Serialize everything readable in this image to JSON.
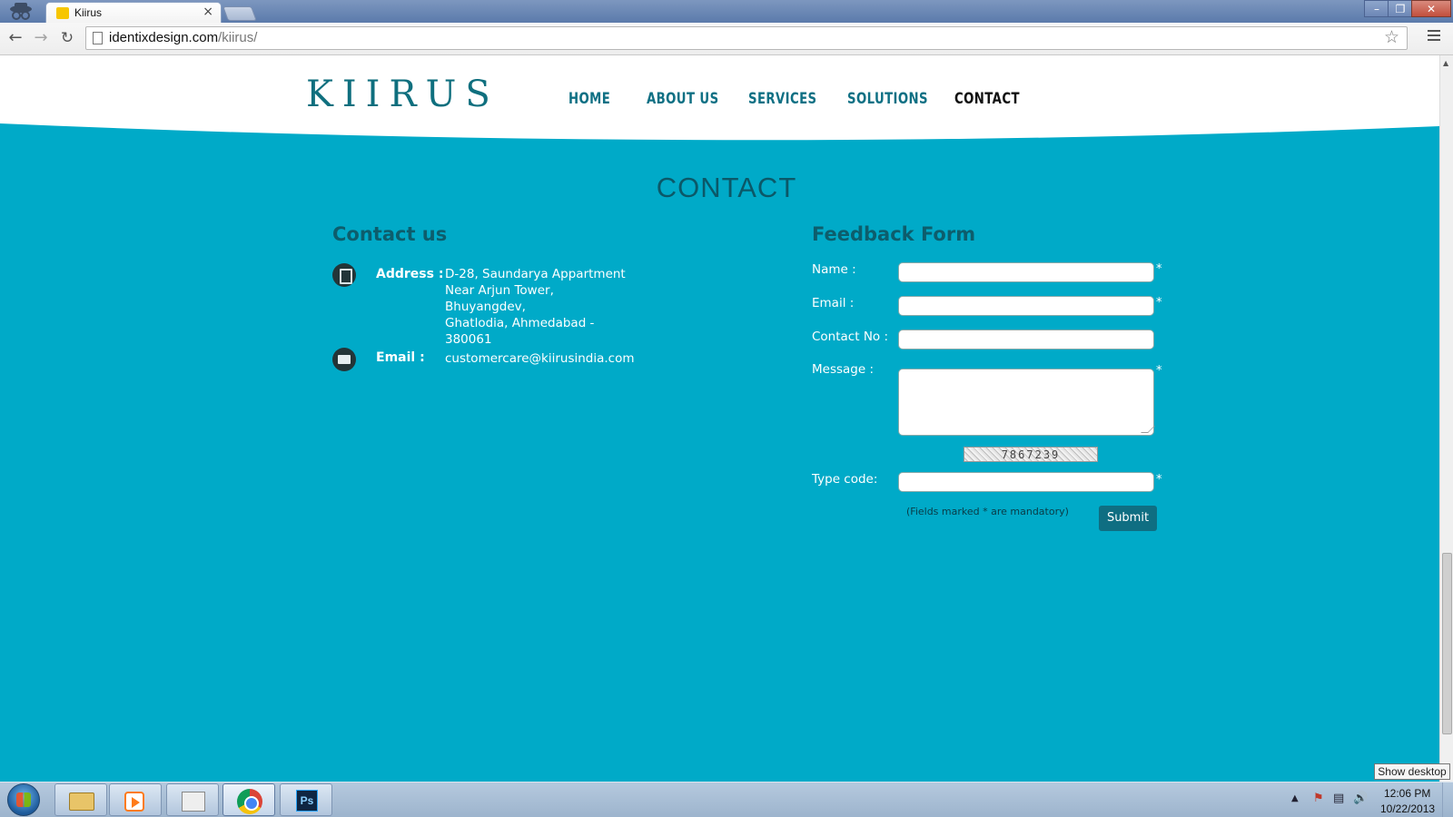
{
  "browser": {
    "tab_title": "Kiirus",
    "tab_close": "×",
    "url_host": "identixdesign.com",
    "url_path": "/kiirus/",
    "window_controls": {
      "minimize": "–",
      "maximize": "❐",
      "close": "✕"
    },
    "icons": [
      "incognito-icon",
      "favicon-icon",
      "back-icon",
      "forward-icon",
      "reload-icon",
      "page-icon",
      "star-icon",
      "menu-icon"
    ]
  },
  "site": {
    "logo": "KIIRUS",
    "nav": [
      "HOME",
      "ABOUT US",
      "SERVICES",
      "SOLUTIONS",
      "CONTACT"
    ],
    "active_nav": "CONTACT",
    "page_heading": "CONTACT",
    "colors": {
      "background": "#00aac8",
      "nav": "#0f7084",
      "heading": "#0b5868",
      "button": "#0f6e82"
    }
  },
  "contact": {
    "title": "Contact us",
    "address_label": "Address :",
    "address_lines": [
      "D-28, Saundarya Appartment",
      "Near Arjun Tower,",
      "Bhuyangdev,",
      "Ghatlodia, Ahmedabad -",
      "380061"
    ],
    "email_label": "Email :",
    "email_value": "customercare@kiirusindia.com"
  },
  "feedback": {
    "title": "Feedback Form",
    "name_label": "Name :",
    "email_label": "Email :",
    "contact_label": "Contact No :",
    "message_label": "Message :",
    "code_label": "Type code:",
    "required_mark": "*",
    "captcha_text": "7867239",
    "mandatory_note": "(Fields marked * are mandatory)",
    "submit_label": "Submit"
  },
  "taskbar": {
    "apps": [
      "windows-explorer",
      "media-player",
      "clock-app",
      "chrome",
      "photoshop"
    ],
    "ps_label": "Ps",
    "time": "12:06 PM",
    "date": "10/22/2013",
    "tooltip": "Show desktop"
  }
}
